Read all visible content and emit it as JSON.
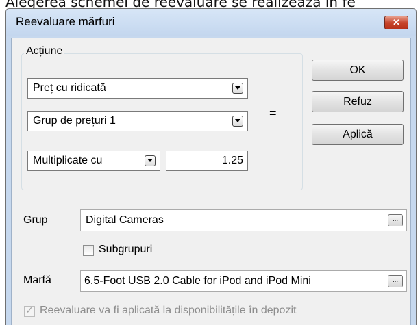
{
  "background_caption": "Alegerea schemei de reevaluare se realizează în fe",
  "window": {
    "title": "Reevaluare mărfuri",
    "close_glyph": "✕"
  },
  "action_group": {
    "legend": "Acțiune",
    "price_type": "Preț cu ridicată",
    "price_group": "Grup de prețuri 1",
    "operation": "Multiplicate cu",
    "factor": "1.25",
    "equals": "="
  },
  "buttons": {
    "ok": "OK",
    "cancel": "Refuz",
    "apply": "Aplică"
  },
  "group_field": {
    "label": "Grup",
    "value": "Digital Cameras",
    "browse": "..."
  },
  "subgroups": {
    "label": "Subgrupuri",
    "checked": false
  },
  "goods_field": {
    "label": "Marfă",
    "value": "6.5-Foot USB 2.0 Cable for iPod and iPod Mini",
    "browse": "..."
  },
  "warehouse_option": {
    "label": "Reevaluare va fi aplicată la disponibilitățile în depozit",
    "checked": true,
    "enabled": false
  },
  "colors": {
    "window_frame": "#c6d8ee",
    "client_bg": "#f0f0f0",
    "close_button": "#c7452b"
  },
  "icons": {
    "close": "close-icon",
    "dropdown": "chevron-down-icon",
    "browse": "ellipsis-icon",
    "check": "checkmark-icon"
  }
}
